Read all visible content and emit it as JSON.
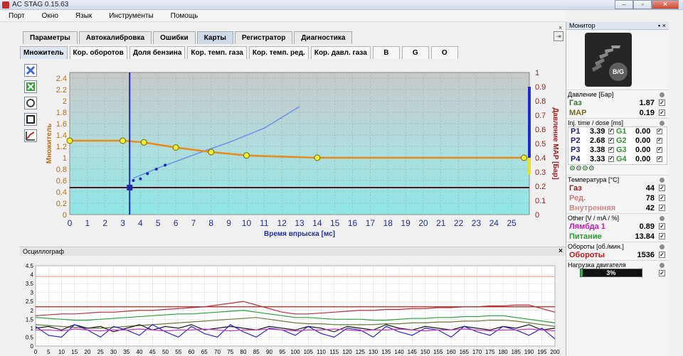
{
  "window": {
    "title": "AC STAG 0.15.63",
    "btn_min": "‒",
    "btn_restore": "▫",
    "btn_close": "✕"
  },
  "menu": [
    "Порт",
    "Окно",
    "Язык",
    "Инструменты",
    "Помощь"
  ],
  "main_tabs": [
    "Параметры",
    "Автокалибровка",
    "Ошибки",
    "Карты",
    "Регистратор",
    "Диагностика"
  ],
  "main_tabs_active": 3,
  "sub_tabs": [
    "Множитель",
    "Кор. оборотов",
    "Доля бензина",
    "Кор. темп. газа",
    "Кор. темп. ред.",
    "Кор. давл. газа",
    "B",
    "G",
    "O"
  ],
  "sub_tabs_active": 0,
  "panel_close": "×",
  "toolbar_icons": [
    "cross-icon",
    "save-icon",
    "refresh-icon",
    "clear-icon",
    "chart-icon"
  ],
  "chart_data": [
    {
      "type": "line",
      "xlabel": "Время впрыска [мс]",
      "ylabel": "Множитель",
      "ylabel_right": "Давление MAP [Бар]",
      "xlim": [
        0,
        26
      ],
      "ylim": [
        0,
        2.5
      ],
      "ylim_right": [
        0,
        1
      ],
      "x_ticks": [
        0,
        1,
        2,
        3,
        4,
        5,
        6,
        7,
        8,
        9,
        10,
        11,
        12,
        13,
        14,
        15,
        16,
        17,
        18,
        19,
        20,
        21,
        22,
        23,
        24,
        25
      ],
      "y_ticks": [
        0,
        0.2,
        0.4,
        0.6,
        0.8,
        1,
        1.2,
        1.4,
        1.6,
        1.8,
        2,
        2.2,
        2.4
      ],
      "y_ticks_right": [
        0,
        0.1,
        0.2,
        0.3,
        0.4,
        0.5,
        0.6,
        0.7,
        0.8,
        0.9,
        1
      ],
      "grid": true,
      "colors": {
        "multiplier": "#e88a1a",
        "gasoline": "#6c8fe8",
        "marker": "#1c2aa8",
        "map_line": "#5a1020",
        "bg_top": "#c8c8c8",
        "bg_bottom": "#8fe6e6"
      },
      "multiplier_points": [
        {
          "x": 0,
          "y": 1.3
        },
        {
          "x": 3,
          "y": 1.3
        },
        {
          "x": 4.2,
          "y": 1.27
        },
        {
          "x": 6,
          "y": 1.18
        },
        {
          "x": 8,
          "y": 1.1
        },
        {
          "x": 10,
          "y": 1.04
        },
        {
          "x": 14,
          "y": 1.0
        },
        {
          "x": 25.7,
          "y": 1.0
        }
      ],
      "gasoline_curve": [
        {
          "x": 3.6,
          "y": 0.64
        },
        {
          "x": 5,
          "y": 0.82
        },
        {
          "x": 7,
          "y": 1.05
        },
        {
          "x": 9,
          "y": 1.27
        },
        {
          "x": 11,
          "y": 1.52
        },
        {
          "x": 13,
          "y": 1.9
        }
      ],
      "gasoline_points": [
        {
          "x": 3.6,
          "y": 0.6
        },
        {
          "x": 4.0,
          "y": 0.63
        },
        {
          "x": 4.4,
          "y": 0.72
        },
        {
          "x": 4.9,
          "y": 0.8
        },
        {
          "x": 5.4,
          "y": 0.87
        }
      ],
      "cursor_x": 3.39,
      "map_level": 0.19
    },
    {
      "type": "line",
      "title": "Осциллограф",
      "xlim": [
        0,
        200
      ],
      "ylim": [
        0,
        4.5
      ],
      "x_ticks": [
        0,
        5,
        10,
        15,
        20,
        25,
        30,
        35,
        40,
        45,
        50,
        55,
        60,
        65,
        70,
        75,
        80,
        85,
        90,
        95,
        100,
        105,
        110,
        115,
        120,
        125,
        130,
        135,
        140,
        145,
        150,
        155,
        160,
        165,
        170,
        175,
        180,
        185,
        190,
        195,
        200
      ],
      "y_ticks": [
        0,
        0.5,
        1,
        1.5,
        2,
        2.5,
        3,
        3.5,
        4,
        4.5
      ],
      "grid": true,
      "series": [
        {
          "color": "#e8a088",
          "values": [
            3.9,
            3.9,
            3.9,
            3.9,
            3.9,
            3.9,
            3.9,
            3.9,
            3.9,
            3.9,
            3.9,
            3.9,
            3.9,
            3.9,
            3.9,
            3.9,
            3.9,
            3.9,
            3.9,
            3.9,
            3.9,
            3.9,
            3.9,
            3.9,
            3.9,
            3.9,
            3.9,
            3.9,
            3.9,
            3.9,
            3.9,
            3.9,
            3.9,
            3.9,
            3.9,
            3.9,
            3.9,
            3.9,
            3.9,
            3.9,
            3.9
          ]
        },
        {
          "color": "#c81818",
          "values": [
            2.2,
            2.2,
            2.2,
            2.2,
            2.2,
            2.2,
            2.2,
            2.2,
            2.2,
            2.2,
            2.2,
            2.2,
            2.2,
            2.2,
            2.2,
            2.2,
            2.2,
            2.2,
            2.2,
            2.2,
            2.2,
            2.2,
            2.2,
            2.2,
            2.2,
            2.2,
            2.2,
            2.2,
            2.2,
            2.2,
            2.2,
            2.2,
            2.2,
            2.2,
            2.2,
            2.2,
            2.2,
            2.2,
            2.2,
            2.2,
            2.2
          ]
        },
        {
          "color": "#b03040",
          "values": [
            1.7,
            1.75,
            1.8,
            1.8,
            1.85,
            1.9,
            1.9,
            1.95,
            2.0,
            2.0,
            2.05,
            2.1,
            2.15,
            2.2,
            2.3,
            2.4,
            2.5,
            2.3,
            2.1,
            1.9,
            1.8,
            1.8,
            1.85,
            1.9,
            1.95,
            2.0,
            2.0,
            2.05,
            2.05,
            2.1,
            2.1,
            2.15,
            2.15,
            2.2,
            2.2,
            2.25,
            2.25,
            2.3,
            2.3,
            2.1,
            1.9
          ]
        },
        {
          "color": "#2d9c3a",
          "values": [
            1.6,
            1.55,
            1.5,
            1.45,
            1.45,
            1.5,
            1.55,
            1.6,
            1.65,
            1.7,
            1.75,
            1.8,
            1.8,
            1.85,
            1.9,
            1.95,
            2.0,
            1.9,
            1.8,
            1.7,
            1.6,
            1.6,
            1.55,
            1.5,
            1.5,
            1.5,
            1.45,
            1.45,
            1.5,
            1.55,
            1.55,
            1.6,
            1.6,
            1.65,
            1.65,
            1.7,
            1.7,
            1.6,
            1.5,
            1.4,
            1.3
          ]
        },
        {
          "color": "#6b7a3a",
          "values": [
            1.2,
            1.15,
            1.1,
            1.05,
            1.0,
            1.0,
            1.05,
            1.1,
            1.15,
            1.2,
            1.25,
            1.3,
            1.35,
            1.4,
            1.45,
            1.5,
            1.55,
            1.6,
            1.5,
            1.4,
            1.3,
            1.25,
            1.25,
            1.2,
            1.2,
            1.2,
            1.2,
            1.25,
            1.25,
            1.3,
            1.3,
            1.35,
            1.35,
            1.4,
            1.4,
            1.45,
            1.45,
            1.4,
            1.3,
            1.2,
            1.1
          ]
        },
        {
          "color": "#1a1a1a",
          "values": [
            1.0,
            1.1,
            0.9,
            1.2,
            1.0,
            1.1,
            0.8,
            1.0,
            1.2,
            0.9,
            1.1,
            1.0,
            1.2,
            0.9,
            1.0,
            1.1,
            1.0,
            0.9,
            1.1,
            1.0,
            0.9,
            1.1,
            1.0,
            0.8,
            1.1,
            1.0,
            0.9,
            1.2,
            1.0,
            0.9,
            1.1,
            1.0,
            0.9,
            1.1,
            1.0,
            0.9,
            1.1,
            1.0,
            1.2,
            0.9,
            1.0
          ]
        },
        {
          "color": "#2a2ac8",
          "values": [
            1.1,
            0.6,
            0.5,
            1.2,
            0.9,
            0.5,
            1.1,
            0.9,
            0.6,
            1.2,
            0.8,
            0.5,
            1.1,
            0.7,
            0.5,
            1.2,
            0.8,
            0.5,
            1.0,
            0.9,
            0.6,
            1.1,
            0.7,
            0.5,
            1.0,
            0.9,
            0.5,
            1.1,
            0.8,
            0.6,
            1.0,
            0.9,
            0.5,
            1.1,
            0.8,
            0.6,
            1.1,
            0.9,
            0.6,
            1.0,
            0.4
          ]
        },
        {
          "color": "#c03ac0",
          "values": [
            0.9,
            0.9,
            0.85,
            0.95,
            0.9,
            0.85,
            0.9,
            0.9,
            0.95,
            0.9,
            0.85,
            0.9,
            0.9,
            0.95,
            0.9,
            0.85,
            0.9,
            0.9,
            0.95,
            0.9,
            0.85,
            0.9,
            0.9,
            0.95,
            0.9,
            0.85,
            0.9,
            0.9,
            0.95,
            0.9,
            0.85,
            0.9,
            0.9,
            0.95,
            0.9,
            0.85,
            0.9,
            0.9,
            0.95,
            0.9,
            0.85
          ]
        }
      ]
    }
  ],
  "osc": {
    "title": "Осциллограф",
    "close": "×"
  },
  "monitor": {
    "title": "Монитор",
    "controls": "▪ ×",
    "logo_text": "B/G",
    "pressure_label": "Давление [Бар]",
    "pressure": [
      {
        "name": "Газ",
        "value": "1.87",
        "color": "#2a7a2a"
      },
      {
        "name": "MAP",
        "value": "0.19",
        "color": "#7a6a1a"
      }
    ],
    "inj_label": "Inj. time / dose [ms]",
    "injectors": [
      {
        "p": "P1",
        "pv": "3.39",
        "g": "G1",
        "gv": "0.00"
      },
      {
        "p": "P2",
        "pv": "2.68",
        "g": "G2",
        "gv": "0.00"
      },
      {
        "p": "P3",
        "pv": "3.38",
        "g": "G3",
        "gv": "0.00"
      },
      {
        "p": "P4",
        "pv": "3.33",
        "g": "G4",
        "gv": "0.00"
      }
    ],
    "plugs": "⚙⚙⚙⚙",
    "temp_label": "Температура [°C]",
    "temps": [
      {
        "name": "Газ",
        "value": "44",
        "color": "#a01818"
      },
      {
        "name": "Ред.",
        "value": "78",
        "color": "#d07878"
      },
      {
        "name": "Внутренняя",
        "value": "42",
        "color": "#d08888"
      }
    ],
    "other_label": "Other [V / mA / %]",
    "other": [
      {
        "name": "Лямбда 1",
        "value": "0.89",
        "color": "#c018c0"
      },
      {
        "name": "Питание",
        "value": "13.84",
        "color": "#2a9a2a"
      }
    ],
    "rpm_label": "Обороты [об./мин.]",
    "rpm": {
      "name": "Обороты",
      "value": "1536",
      "color": "#c01818"
    },
    "load_label": "Нагрузка двигателя",
    "load_text": "3%",
    "load_percent": 3
  }
}
